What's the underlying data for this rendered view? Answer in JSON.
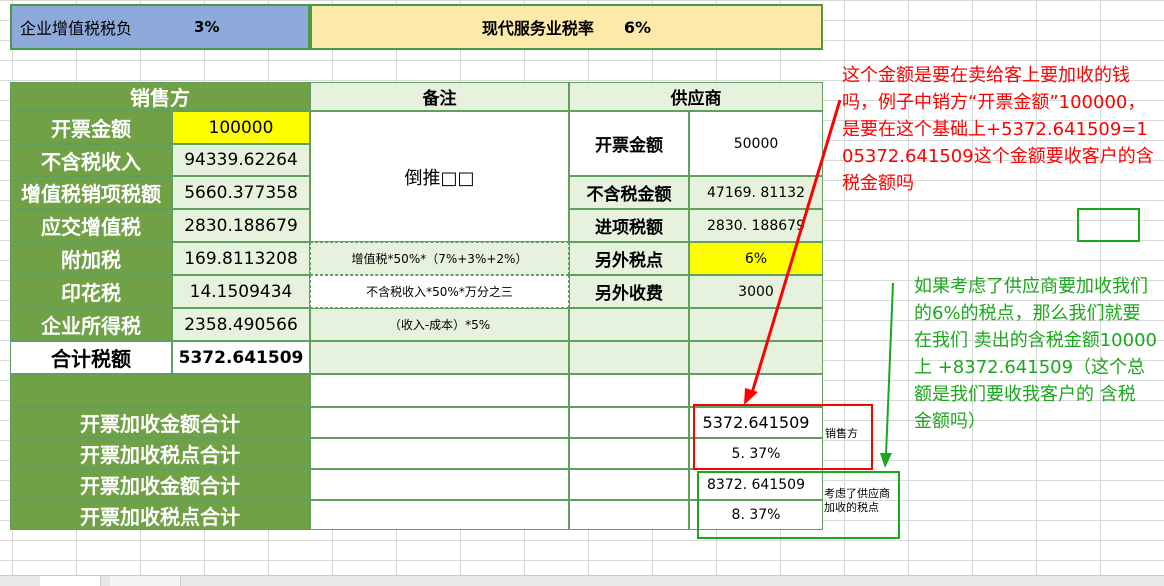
{
  "top": {
    "vat_burden_label": "企业增值税税负",
    "vat_burden_value": "3%",
    "service_rate_label": "现代服务业税率",
    "service_rate_value": "6%"
  },
  "headers": {
    "seller": "销售方",
    "remarks": "备注",
    "supplier": "供应商"
  },
  "seller": {
    "invoice_amount_label": "开票金额",
    "invoice_amount": "100000",
    "net_income_label": "不含税收入",
    "net_income": "94339.62264",
    "output_vat_label": "增值税销项税额",
    "output_vat": "5660.377358",
    "vat_payable_label": "应交增值税",
    "vat_payable": "2830.188679",
    "surcharge_label": "附加税",
    "surcharge": "169.8113208",
    "stamp_label": "印花税",
    "stamp": "14.1509434",
    "income_tax_label": "企业所得税",
    "income_tax": "2358.490566",
    "total_label": "合计税额",
    "total": "5372.641509"
  },
  "remarks": {
    "reverse": "倒推□□",
    "surcharge_formula": "增值税*50%*（7%+3%+2%）",
    "stamp_formula": "不含税收入*50%*万分之三",
    "income_formula": "（收入-成本）*5%"
  },
  "supplier": {
    "invoice_amount_label": "开票金额",
    "invoice_amount": "50000",
    "net_amount_label": "不含税金额",
    "net_amount": "47169. 81132",
    "input_tax_label": "进项税额",
    "input_tax": "2830. 188679",
    "extra_rate_label": "另外税点",
    "extra_rate": "6%",
    "extra_fee_label": "另外收费",
    "extra_fee": "3000"
  },
  "summary": {
    "rows": [
      {
        "label": "开票加收金额合计",
        "value": "5372.641509"
      },
      {
        "label": "开票加收税点合计",
        "value": "5. 37%"
      },
      {
        "label": "开票加收金额合计",
        "value": "8372. 641509"
      },
      {
        "label": "开票加收税点合计",
        "value": "8. 37%"
      }
    ],
    "tag_seller": "销售方",
    "tag_supplier": "考虑了供应商加收的税点"
  },
  "annotations": {
    "red": "这个金额是要在卖给客上要加收的钱吗，例子中销方“开票金额”100000，是要在这个基础上+5372.641509=105372.641509这个金额要收客户的含税金额吗",
    "green": "如果考虑了供应商要加收我们的6%的税点，那么我们就要在我们 卖出的含税金额10000上 +8372.641509（这个总额是我们要收我客户的 含税 金额吗）"
  },
  "colors": {
    "header_green": "#70a146",
    "cell_green": "#e6f2dd",
    "highlight_yellow": "#ffff00",
    "annotation_red": "#ff0000",
    "annotation_green": "#1aa81a",
    "blue_cell": "#8eaadb",
    "cream_cell": "#fde9a9"
  }
}
